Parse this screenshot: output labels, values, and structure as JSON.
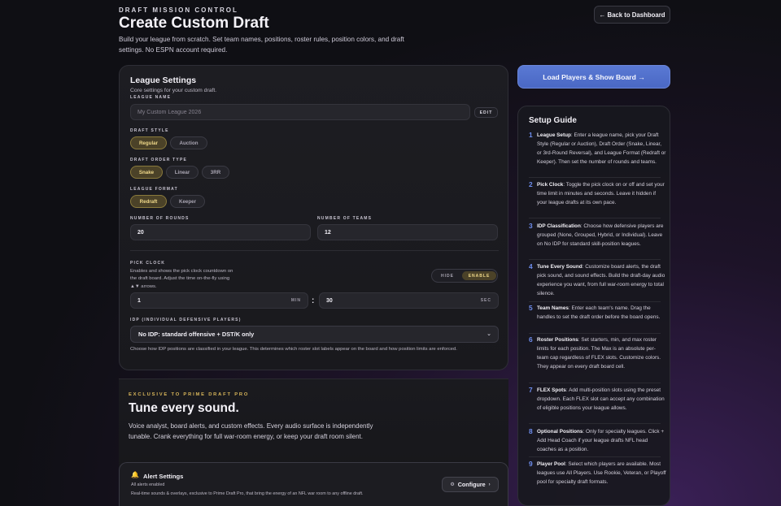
{
  "header": {
    "eyebrow": "DRAFT MISSION CONTROL",
    "title": "Create Custom Draft",
    "subtitle": "Build your league from scratch. Set team names, positions, roster rules, position colors, and draft settings. No ESPN account required.",
    "back_label": "← Back to Dashboard"
  },
  "settings": {
    "title": "League Settings",
    "subtitle": "Core settings for your custom draft.",
    "league_name_label": "LEAGUE NAME",
    "league_name_placeholder": "My Custom League 2026",
    "edit_label": "EDIT",
    "draft_style_label": "DRAFT STYLE",
    "draft_style_options": [
      "Regular",
      "Auction"
    ],
    "draft_order_label": "DRAFT ORDER TYPE",
    "draft_order_options": [
      "Snake",
      "Linear",
      "3RR"
    ],
    "league_format_label": "LEAGUE FORMAT",
    "league_format_options": [
      "Redraft",
      "Keeper"
    ],
    "rounds_label": "NUMBER OF ROUNDS",
    "rounds_value": "20",
    "teams_label": "NUMBER OF TEAMS",
    "teams_value": "12",
    "pick_clock_label": "PICK CLOCK",
    "pick_clock_desc": "Enables and shows the pick clock countdown on the draft board. Adjust the time on-the-fly using ▲▼ arrows.",
    "toggle_hide": "HIDE",
    "toggle_enable": "ENABLE",
    "minutes_value": "1",
    "minutes_unit": "MIN",
    "colon": ":",
    "seconds_value": "30",
    "seconds_unit": "SEC",
    "idp_label": "IDP (INDIVIDUAL DEFENSIVE PLAYERS)",
    "idp_selected": "No IDP: standard offensive + DST/K only",
    "idp_desc": "Choose how IDP positions are classified in your league. This determines which roster slot labels appear on the board and how position limits are enforced."
  },
  "pro": {
    "eyebrow": "EXCLUSIVE TO PRIME DRAFT PRO",
    "title": "Tune every sound.",
    "desc": "Voice analyst, board alerts, and custom effects. Every audio surface is independently tunable. Crank everything for full war-room energy, or keep your draft room silent.",
    "alert_title": "Alert Settings",
    "alert_sub": "All alerts enabled",
    "alert_desc": "Real-time sounds & overlays, exclusive to Prime Draft Pro, that bring the energy of an NFL war room to any offline draft.",
    "configure_label": "Configure"
  },
  "load_button": "Load Players & Show Board →",
  "guide": {
    "title": "Setup Guide",
    "items": [
      {
        "num": "1",
        "title": "League Setup",
        "body": ": Enter a league name, pick your Draft Style (Regular or Auction), Draft Order (Snake, Linear, or 3rd-Round Reversal), and League Format (Redraft or Keeper). Then set the number of rounds and teams."
      },
      {
        "num": "2",
        "title": "Pick Clock",
        "body": ": Toggle the pick clock on or off and set your time limit in minutes and seconds. Leave it hidden if your league drafts at its own pace."
      },
      {
        "num": "3",
        "title": "IDP Classification",
        "body": ": Choose how defensive players are grouped (None, Grouped, Hybrid, or Individual). Leave on No IDP for standard skill-position leagues."
      },
      {
        "num": "4",
        "title": "Tune Every Sound",
        "body": ": Customize board alerts, the draft pick sound, and sound effects. Build the draft-day audio experience you want, from full war-room energy to total silence."
      },
      {
        "num": "5",
        "title": "Team Names",
        "body": ": Enter each team's name. Drag the handles to set the draft order before the board opens."
      },
      {
        "num": "6",
        "title": "Roster Positions",
        "body": ": Set starters, min, and max roster limits for each position. The Max is an absolute per-team cap regardless of FLEX slots. Customize colors. They appear on every draft board cell."
      },
      {
        "num": "7",
        "title": "FLEX Spots",
        "body": ": Add multi-position slots using the preset dropdown. Each FLEX slot can accept any combination of eligible positions your league allows."
      },
      {
        "num": "8",
        "title": "Optional Positions",
        "body": ": Only for specialty leagues. Click + Add Head Coach if your league drafts NFL head coaches as a position."
      },
      {
        "num": "9",
        "title": "Player Pool",
        "body": ": Select which players are available. Most leagues use All Players. Use Rookie, Veteran, or Playoff pool for specialty draft formats."
      }
    ]
  }
}
